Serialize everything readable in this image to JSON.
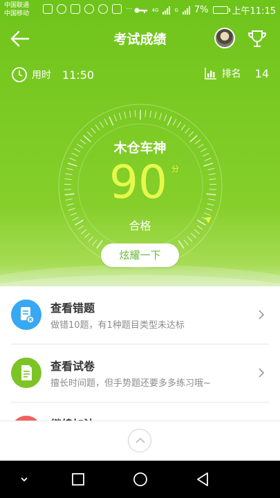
{
  "status_bar": {
    "carrier_1": "中国联通",
    "carrier_2": "中国移动",
    "network_1": "4G",
    "network_2": "G",
    "battery": "7%",
    "time": "上午11:15",
    "more": "···"
  },
  "header": {
    "title": "考试成绩"
  },
  "stats": {
    "time_label": "用时",
    "time_value": "11:50",
    "rank_label": "排名",
    "rank_value": "14"
  },
  "score": {
    "name": "木仓车神",
    "value": "90",
    "unit": "分",
    "result": "合格",
    "gauge_fraction": 0.9
  },
  "share_button": "炫耀一下",
  "list": [
    {
      "title": "查看错题",
      "subtitle": "做错10题，有1种题目类型未达标",
      "icon": "wrong-questions-icon",
      "color": "#37a8f1"
    },
    {
      "title": "查看试卷",
      "subtitle": "擅长时间题，但手势题还要多多练习哦~",
      "icon": "exam-paper-icon",
      "color": "#7cc325"
    },
    {
      "title": "继续加油",
      "subtitle": "",
      "icon": "keep-going-icon",
      "color": "#f26060"
    }
  ],
  "colors": {
    "primary": "#6fc41c",
    "score": "#e6f94b",
    "pointer": "#e6f94b"
  }
}
